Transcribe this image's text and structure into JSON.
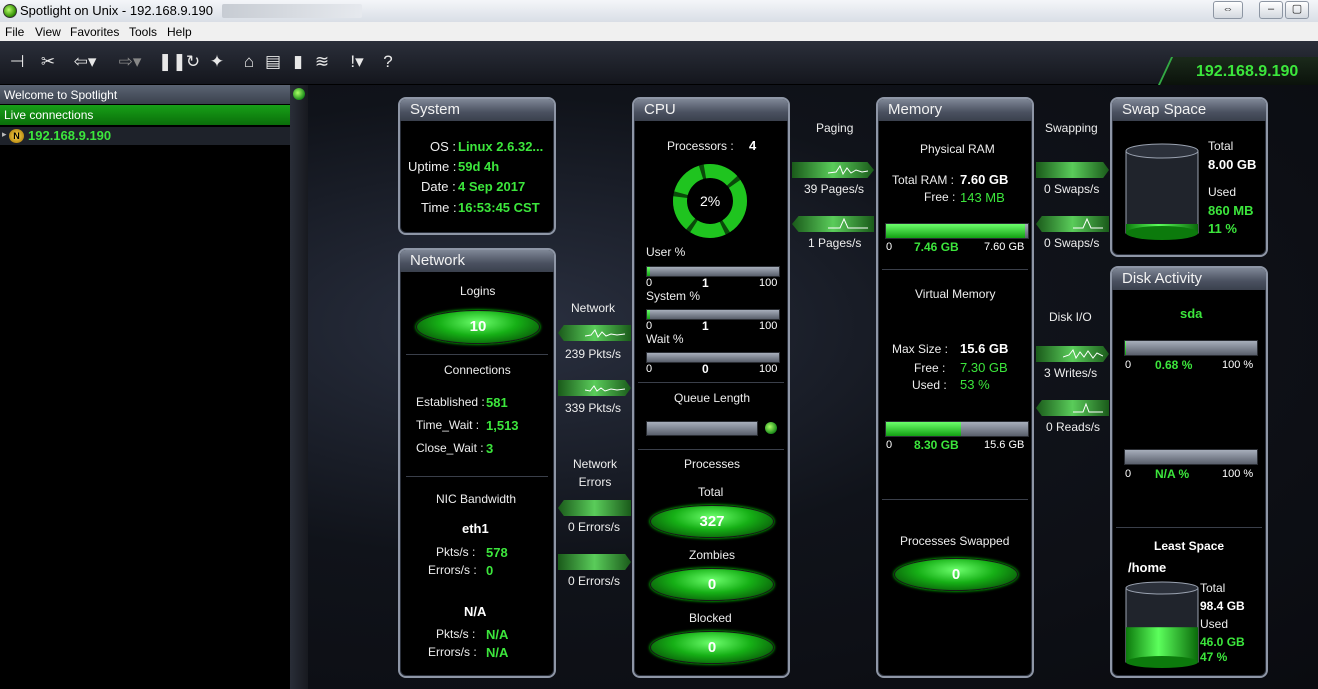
{
  "window": {
    "title": "Spotlight on Unix - 192.168.9.190"
  },
  "menu": [
    "File",
    "View",
    "Favorites",
    "Tools",
    "Help"
  ],
  "host_banner": "192.168.9.190",
  "sidebar": {
    "welcome": "Welcome to Spotlight",
    "live": "Live connections",
    "host": "192.168.9.190"
  },
  "system": {
    "title": "System",
    "os_label": "OS :",
    "os": "Linux 2.6.32...",
    "uptime_label": "Uptime :",
    "uptime": "59d 4h",
    "date_label": "Date :",
    "date": "4 Sep 2017",
    "time_label": "Time :",
    "time": "16:53:45 CST"
  },
  "network": {
    "title": "Network",
    "logins_label": "Logins",
    "logins": "10",
    "connections_label": "Connections",
    "est_label": "Established :",
    "est": "581",
    "tw_label": "Time_Wait :",
    "tw": "1,513",
    "cw_label": "Close_Wait :",
    "cw": "3",
    "nic_label": "NIC Bandwidth",
    "if1": "eth1",
    "pkts_label": "Pkts/s :",
    "if1_pkts": "578",
    "err_label": "Errors/s :",
    "if1_err": "0",
    "if2": "N/A",
    "if2_pkts": "N/A",
    "if2_err": "N/A"
  },
  "flows": {
    "network_label": "Network",
    "net_in": "239 Pkts/s",
    "net_out": "339 Pkts/s",
    "net_err_label": "Network\nErrors",
    "err_in": "0 Errors/s",
    "err_out": "0 Errors/s",
    "paging_label": "Paging",
    "page_in": "39 Pages/s",
    "page_out": "1 Pages/s",
    "swapping_label": "Swapping",
    "swap_in": "0 Swaps/s",
    "swap_out": "0 Swaps/s",
    "diskio_label": "Disk I/O",
    "writes": "3 Writes/s",
    "reads": "0 Reads/s"
  },
  "cpu": {
    "title": "CPU",
    "processors_label": "Processors :",
    "processors": "4",
    "usage": "2%",
    "usage_fraction": 0.02,
    "user_label": "User %",
    "user_val": "1",
    "user_fraction": 0.01,
    "sys_label": "System %",
    "sys_val": "1",
    "sys_fraction": 0.01,
    "wait_label": "Wait %",
    "wait_val": "0",
    "wait_fraction": 0,
    "scale_min": "0",
    "scale_max": "100",
    "queue_label": "Queue Length",
    "processes_label": "Processes",
    "total_label": "Total",
    "total": "327",
    "zombies_label": "Zombies",
    "zombies": "0",
    "blocked_label": "Blocked",
    "blocked": "0"
  },
  "memory": {
    "title": "Memory",
    "phys_label": "Physical RAM",
    "total_ram_label": "Total RAM :",
    "total_ram": "7.60 GB",
    "free_label": "Free :",
    "free": "143 MB",
    "phys_min": "0",
    "phys_used": "7.46 GB",
    "phys_max": "7.60 GB",
    "phys_fraction": 0.98,
    "virt_label": "Virtual Memory",
    "max_label": "Max Size :",
    "max": "15.6 GB",
    "vfree_label": "Free :",
    "vfree": "7.30 GB",
    "vused_label": "Used :",
    "vused": "53 %",
    "virt_min": "0",
    "virt_used": "8.30 GB",
    "virt_max": "15.6 GB",
    "virt_fraction": 0.53,
    "swapped_label": "Processes Swapped",
    "swapped": "0"
  },
  "swap": {
    "title": "Swap Space",
    "total_label": "Total",
    "total": "8.00 GB",
    "used_label": "Used",
    "used": "860 MB",
    "pct": "11 %",
    "fraction": 0.11
  },
  "disk": {
    "title": "Disk Activity",
    "dev": "sda",
    "min": "0",
    "d1_val": "0.68 %",
    "d1_fraction": 0.0068,
    "max": "100 %",
    "d2_val": "N/A %",
    "d2_fraction": 0,
    "least_label": "Least Space",
    "mount": "/home",
    "total_label": "Total",
    "total": "98.4 GB",
    "used_label": "Used",
    "used": "46.0 GB",
    "pct": "47 %",
    "fraction": 0.47
  }
}
